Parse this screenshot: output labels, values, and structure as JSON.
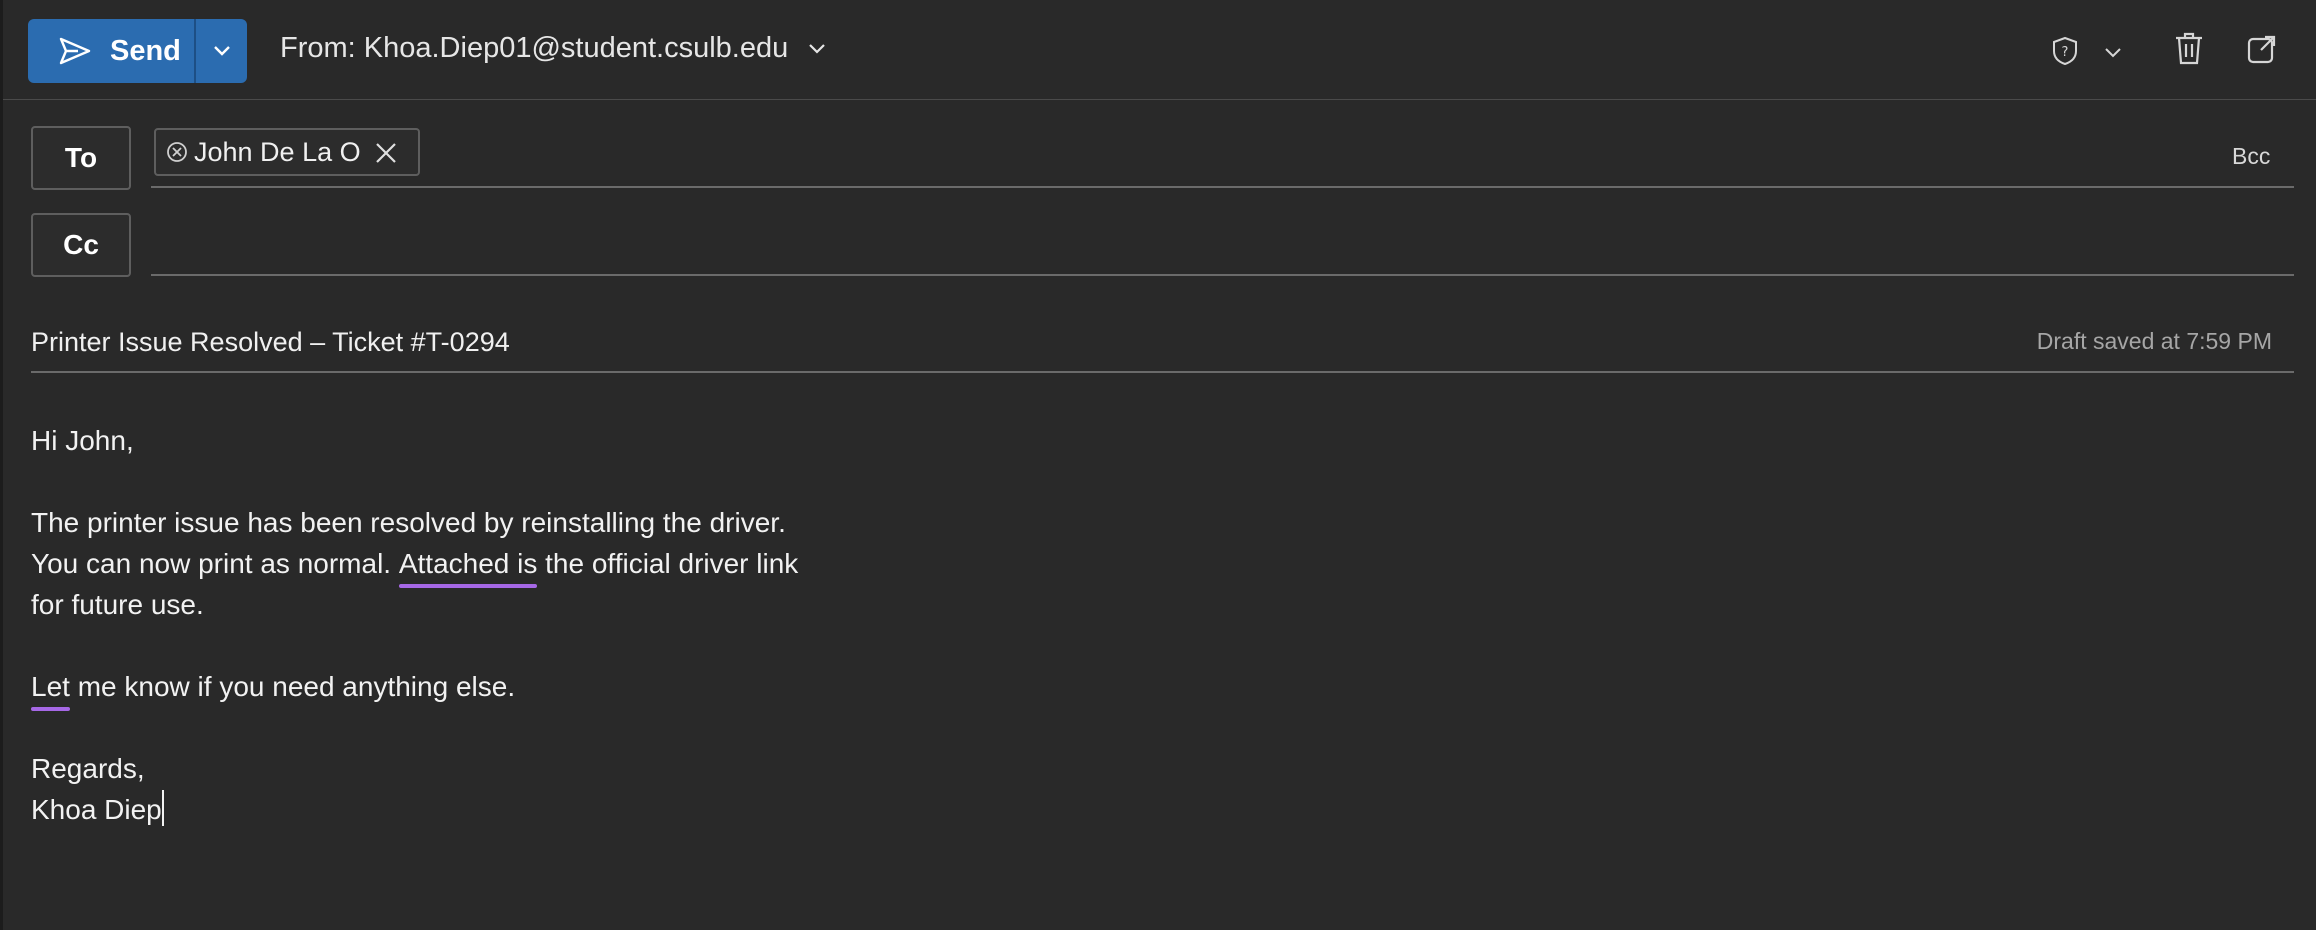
{
  "toolbar": {
    "send_label": "Send",
    "from_label": "From: Khoa.Diep01@student.csulb.edu"
  },
  "recipients": {
    "to_label": "To",
    "cc_label": "Cc",
    "bcc_label": "Bcc",
    "to_chips": [
      {
        "name": "John De La O"
      }
    ]
  },
  "subject": {
    "value": "Printer Issue Resolved – Ticket #T-0294",
    "draft_status": "Draft saved at 7:59 PM"
  },
  "body": {
    "greeting": "Hi John,",
    "line1": "The printer issue has been resolved by reinstalling the driver.",
    "line2_pre": "You can now print as normal. ",
    "line2_mark": "Attached is",
    "line2_post": " the official driver link",
    "line3": "for future use.",
    "line4_mark": "Let",
    "line4_post": " me know if you need anything else.",
    "closing": "Regards,",
    "signature": "Khoa Diep"
  },
  "colors": {
    "send_button": "#2b6cb0",
    "background": "#292929",
    "spellcheck_underline": "#a668e6"
  },
  "icons": [
    "send-icon",
    "chevron-down-icon",
    "sensitivity-icon",
    "trash-icon",
    "popout-icon",
    "remove-recipient-icon",
    "close-icon"
  ]
}
